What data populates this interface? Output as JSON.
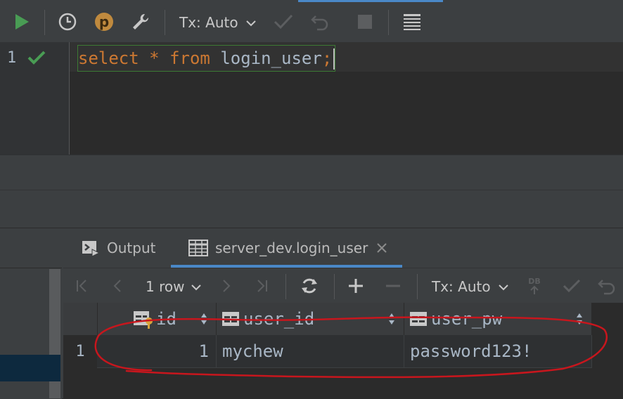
{
  "toolbar": {
    "tx_label": "Tx: Auto",
    "icons": [
      "run-icon",
      "history-icon",
      "p-badge-icon",
      "settings-wrench-icon",
      "commit-check-icon",
      "rollback-icon",
      "stop-icon",
      "table-view-icon"
    ],
    "badge_letter": "p",
    "colors": {
      "run": "#499c54",
      "badge": "#c08a3e",
      "progress": "#4a88c7"
    }
  },
  "editor": {
    "line_number": "1",
    "code": {
      "kw_select": "select",
      "star": "*",
      "kw_from": "from",
      "table": "login_user",
      "semicolon": ";"
    }
  },
  "services": {
    "tabs": [
      {
        "label": "Output"
      },
      {
        "label": "server_dev.login_user"
      }
    ],
    "result_toolbar": {
      "rows_label": "1 row",
      "tx_label": "Tx: Auto",
      "db_label": "DB"
    },
    "grid": {
      "columns": [
        "id",
        "user_id",
        "user_pw"
      ],
      "rows": [
        {
          "num": "1",
          "id": "1",
          "user_id": "mychew",
          "user_pw": "password123!"
        }
      ]
    }
  }
}
